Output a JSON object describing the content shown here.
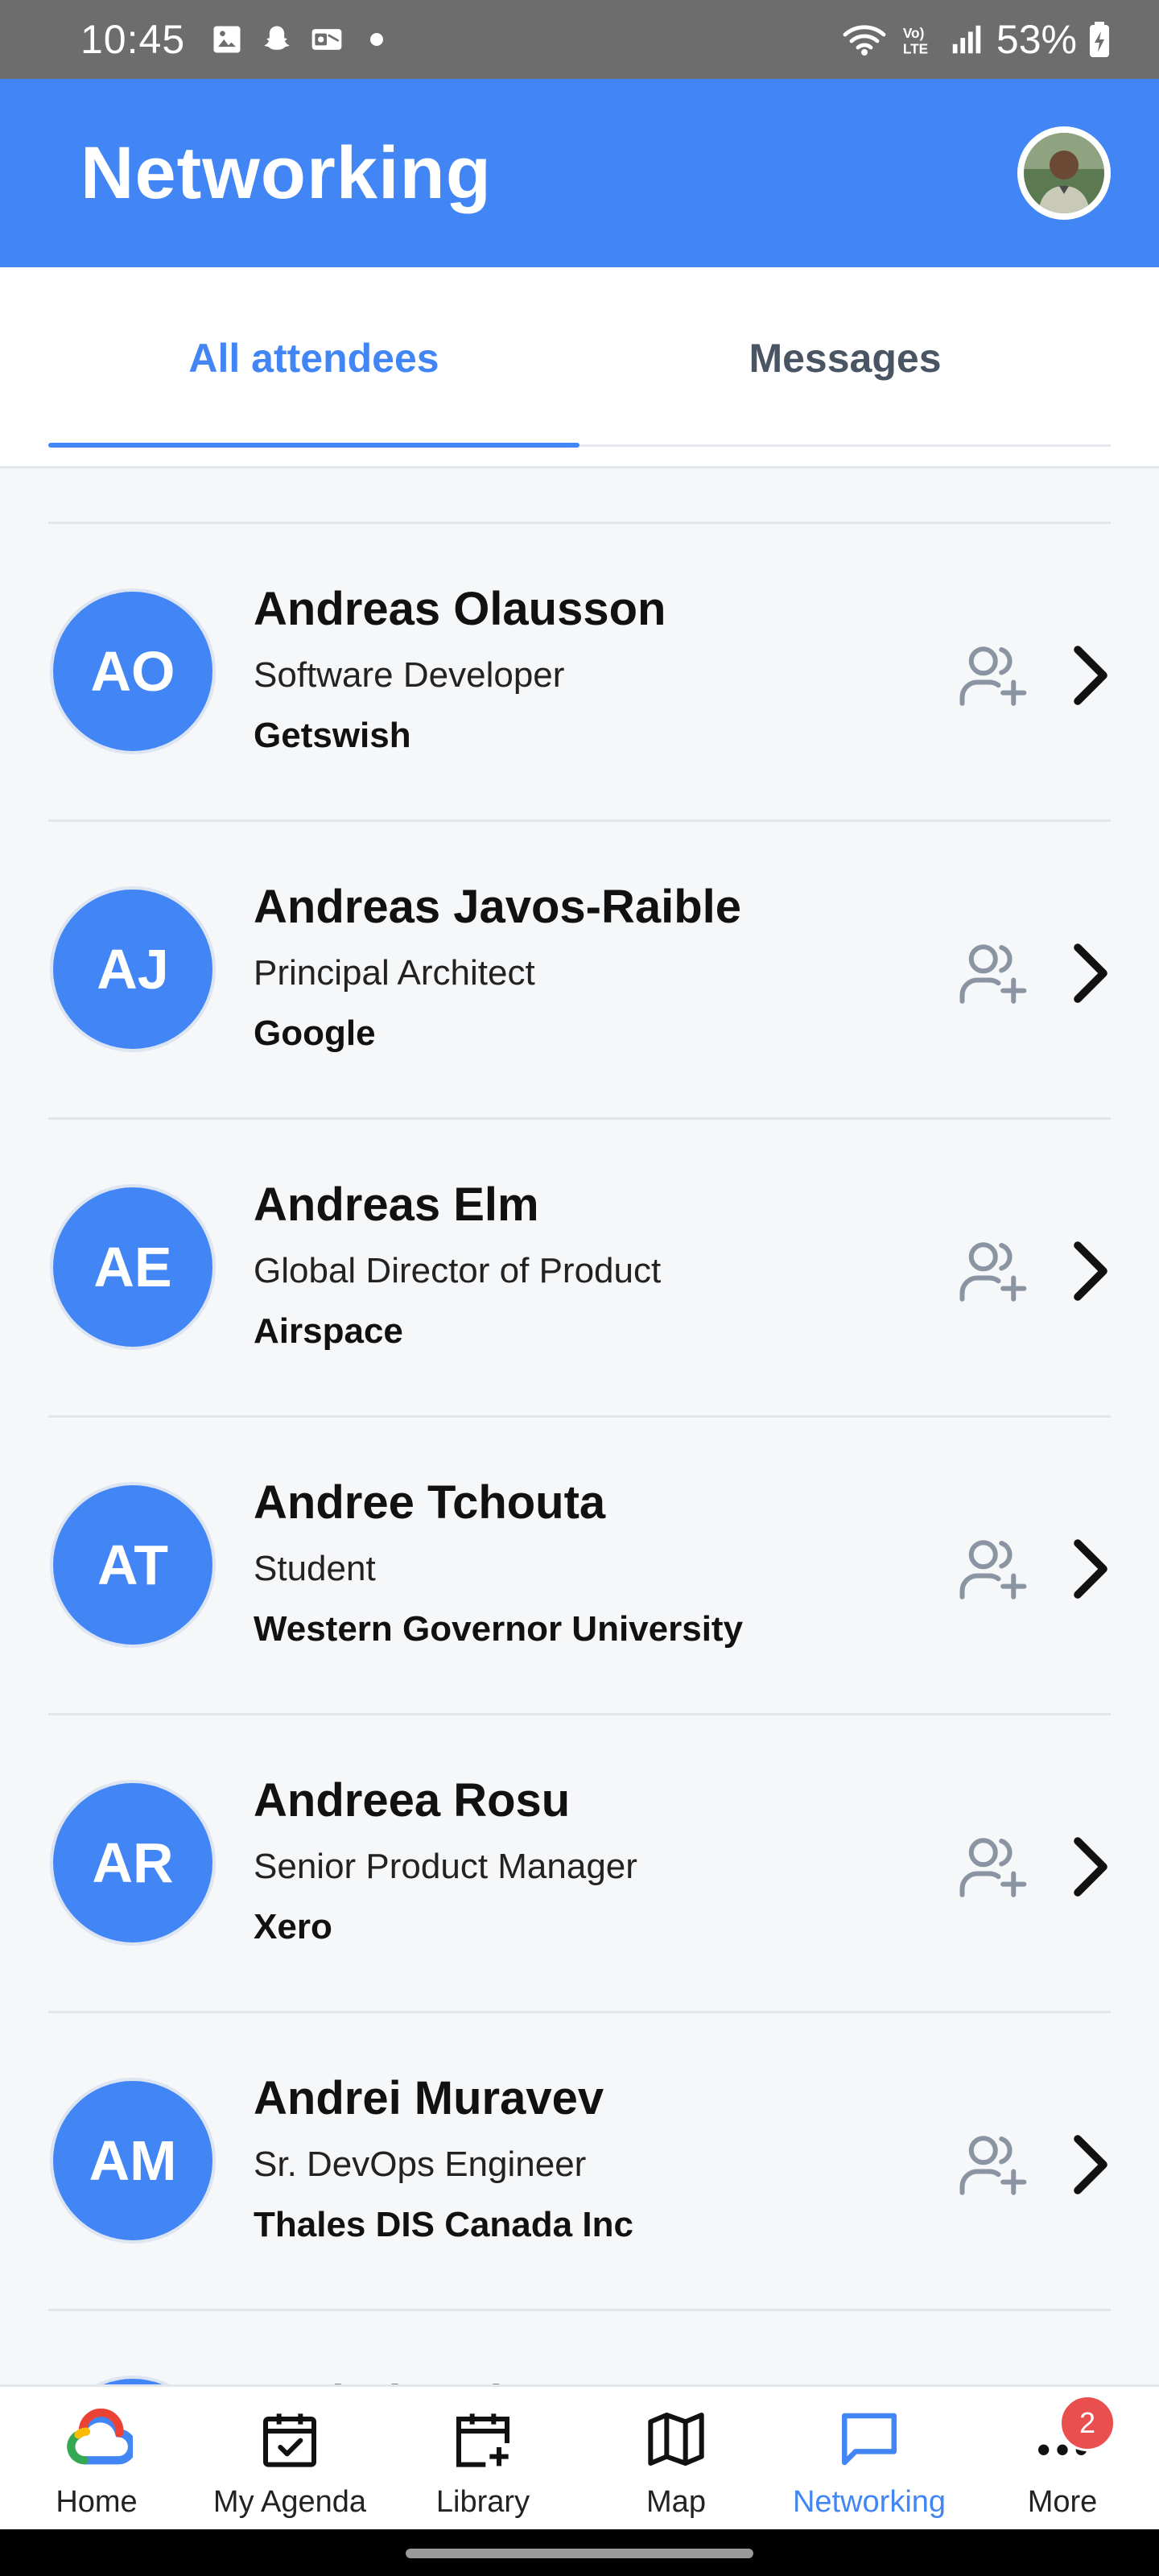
{
  "status_bar": {
    "time": "10:45",
    "battery": "53%"
  },
  "app_bar": {
    "title": "Networking"
  },
  "tabs": [
    {
      "label": "All attendees",
      "active": true
    },
    {
      "label": "Messages",
      "active": false
    }
  ],
  "attendees": [
    {
      "initials": "AO",
      "name": "Andreas Olausson",
      "role": "Software Developer",
      "company": "Getswish"
    },
    {
      "initials": "AJ",
      "name": "Andreas Javos-Raible",
      "role": "Principal Architect",
      "company": "Google"
    },
    {
      "initials": "AE",
      "name": "Andreas Elm",
      "role": "Global Director of Product",
      "company": "Airspace"
    },
    {
      "initials": "AT",
      "name": "Andree Tchouta",
      "role": "Student",
      "company": "Western Governor University"
    },
    {
      "initials": "AR",
      "name": "Andreea Rosu",
      "role": "Senior Product Manager",
      "company": "Xero"
    },
    {
      "initials": "AM",
      "name": "Andrei Muravev",
      "role": "Sr. DevOps Engineer",
      "company": "Thales DIS Canada Inc"
    }
  ],
  "partial_row_name": "Andrei Pud",
  "bottom_nav": [
    {
      "label": "Home",
      "icon": "google-cloud-icon",
      "active": false
    },
    {
      "label": "My Agenda",
      "icon": "calendar-check-icon",
      "active": false
    },
    {
      "label": "Library",
      "icon": "calendar-add-icon",
      "active": false
    },
    {
      "label": "Map",
      "icon": "map-icon",
      "active": false
    },
    {
      "label": "Networking",
      "icon": "chat-icon",
      "active": true
    },
    {
      "label": "More",
      "icon": "more-horizontal-icon",
      "active": false,
      "badge": "2"
    }
  ],
  "colors": {
    "primary": "#4285f4",
    "status_bar": "#6d6d6d",
    "badge": "#ea4f4f"
  }
}
